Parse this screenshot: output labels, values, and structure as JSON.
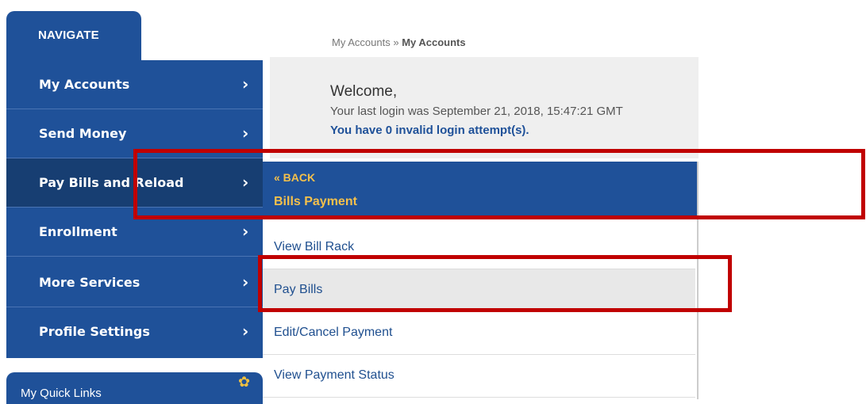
{
  "nav": {
    "tab_label": "NAVIGATE"
  },
  "sidebar": {
    "items": [
      {
        "label": "My Accounts",
        "chevron": "›"
      },
      {
        "label": "Send Money",
        "chevron": "›"
      },
      {
        "label": "Pay Bills and Reload",
        "chevron": "›"
      },
      {
        "label": "Enrollment",
        "chevron": "›"
      },
      {
        "label": "More Services",
        "chevron": "›"
      },
      {
        "label": "Profile Settings",
        "chevron": "›"
      }
    ]
  },
  "quick_links": {
    "label": "My Quick Links",
    "icon": "gear-icon"
  },
  "breadcrumb": {
    "parent": "My Accounts",
    "sep": "»",
    "current": "My Accounts"
  },
  "welcome": {
    "greeting": "Welcome,",
    "last_login": "Your last login was September 21, 2018, 15:47:21 GMT",
    "invalid_attempts": "You have 0 invalid login attempt(s)."
  },
  "submenu": {
    "back_label": "« BACK",
    "title": "Bills Payment",
    "items": [
      {
        "label": "View Bill Rack"
      },
      {
        "label": "Pay Bills"
      },
      {
        "label": "Edit/Cancel Payment"
      },
      {
        "label": "View Payment Status"
      }
    ]
  },
  "colors": {
    "brand": "#1f5199",
    "accent": "#f4c04b",
    "annotation": "#c00000"
  }
}
